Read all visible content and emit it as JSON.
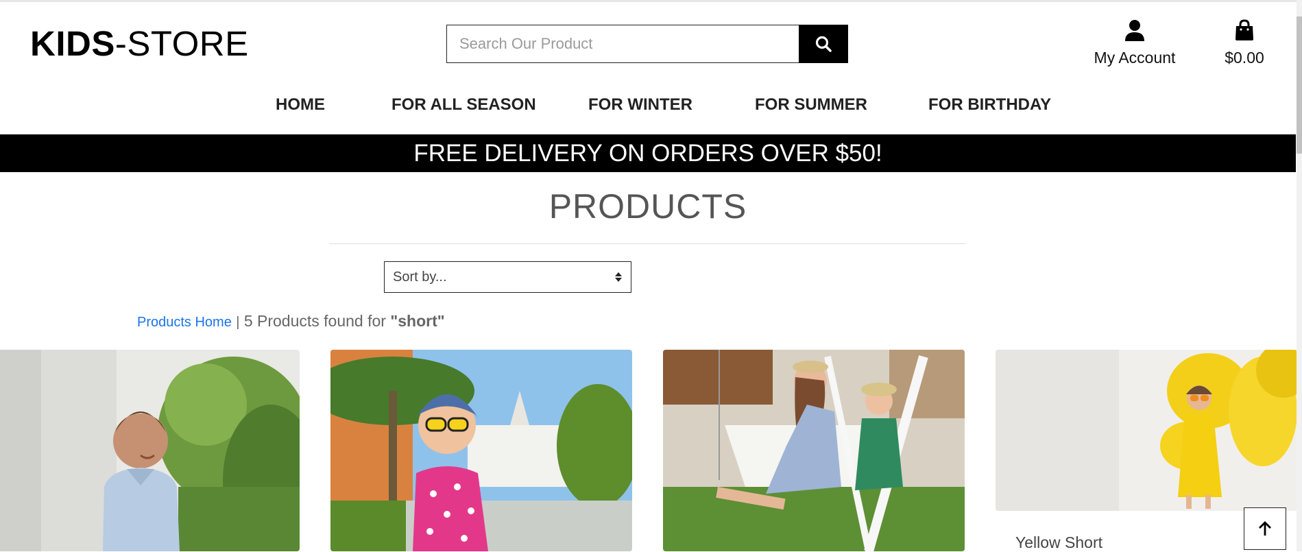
{
  "header": {
    "logo_bold": "KIDS",
    "logo_rest": "-STORE",
    "search_placeholder": "Search Our Product",
    "account_label": "My Account",
    "cart_total": "$0.00"
  },
  "nav": {
    "items": [
      {
        "label": "HOME"
      },
      {
        "label": "FOR ALL SEASON"
      },
      {
        "label": "FOR WINTER"
      },
      {
        "label": "FOR SUMMER"
      },
      {
        "label": "FOR BIRTHDAY"
      }
    ]
  },
  "banner": {
    "text": "FREE DELIVERY ON ORDERS OVER $50!"
  },
  "page": {
    "title": "PRODUCTS",
    "sort_selected": "Sort by...",
    "breadcrumb": "Products Home",
    "separator": "|",
    "results_text": "5 Products found for",
    "results_query": "\"short\""
  },
  "products": [
    {
      "title": "Yellow Short"
    }
  ],
  "icons": {
    "search": "search-icon",
    "account": "user-icon",
    "cart": "shopping-bag-icon",
    "back_to_top": "arrow-up-icon",
    "sort": "sort-arrows-icon"
  },
  "colors": {
    "banner_bg": "#000000",
    "link": "#1a73e8",
    "title": "#555555"
  }
}
